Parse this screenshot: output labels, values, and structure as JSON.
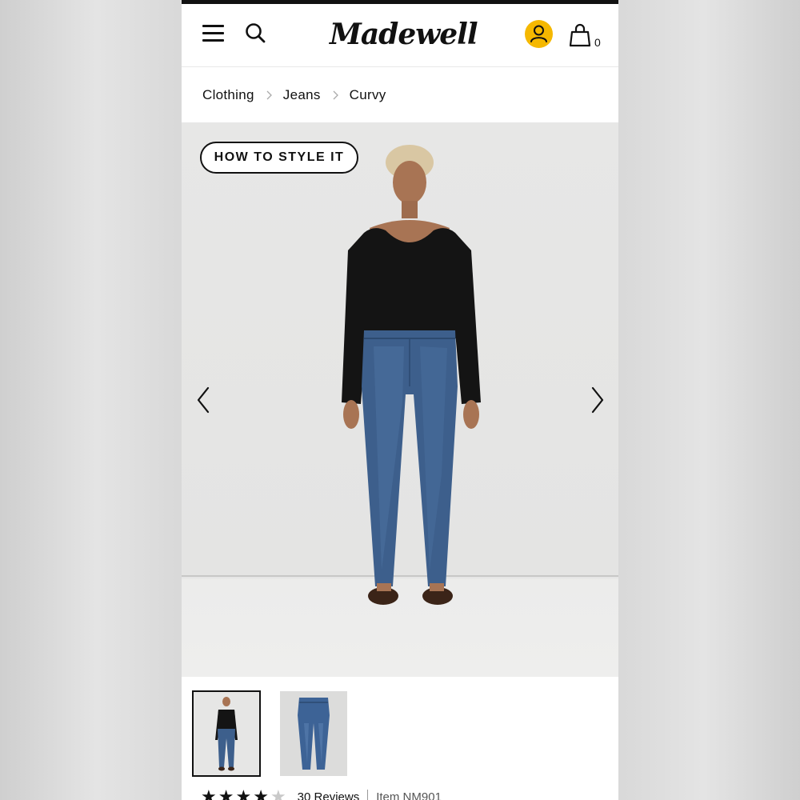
{
  "header": {
    "logo_text": "Madewell",
    "bag_count": "0",
    "account_color": "#f5b800"
  },
  "breadcrumb": {
    "items": [
      "Clothing",
      "Jeans",
      "Curvy"
    ]
  },
  "hero": {
    "style_button_label": "HOW TO STYLE IT"
  },
  "product": {
    "rating": 4,
    "reviews_label": "30 Reviews",
    "item_number": "Item NM901"
  },
  "icons": [
    "hamburger-menu-icon",
    "search-icon",
    "account-icon",
    "shopping-bag-icon",
    "chevron-right-icon",
    "chevron-left-icon",
    "star-icon"
  ]
}
